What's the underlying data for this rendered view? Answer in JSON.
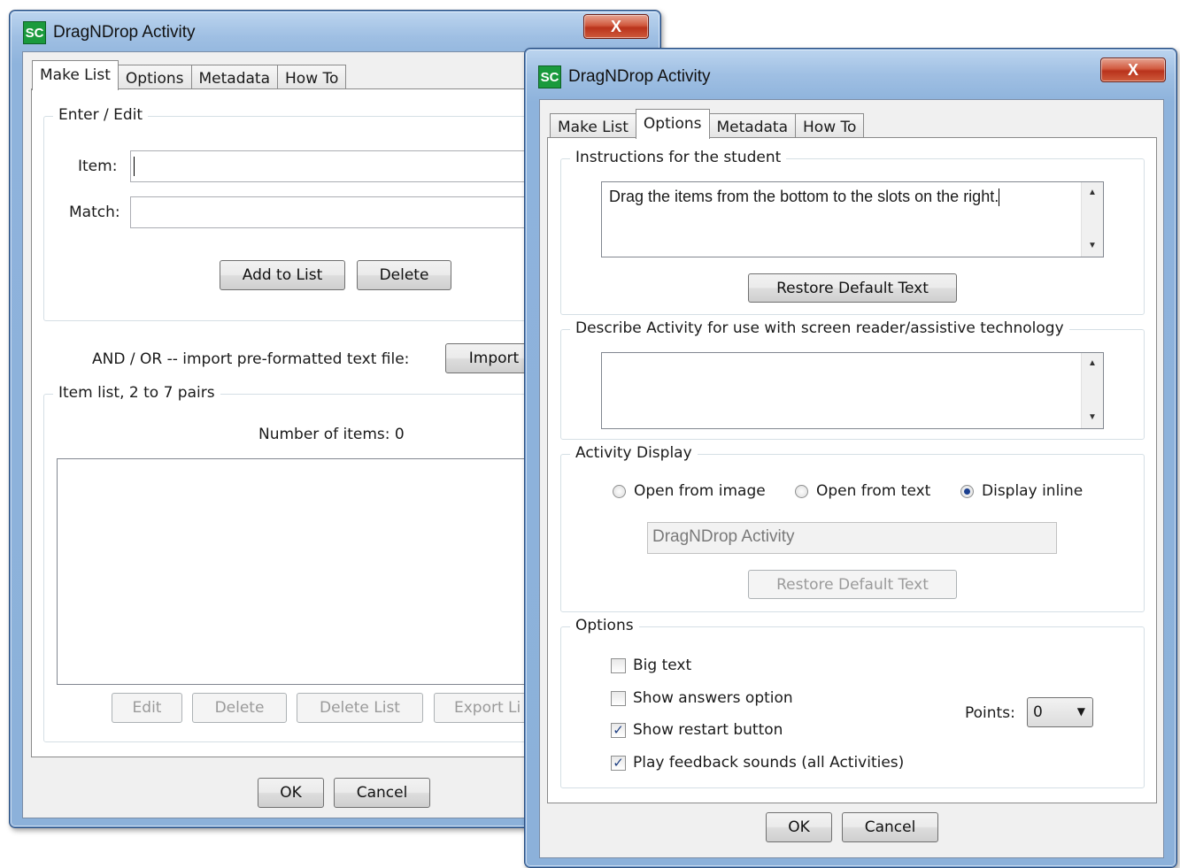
{
  "back_window": {
    "title": "DragNDrop Activity",
    "app_icon": "SC",
    "close_label": "X",
    "tabs": [
      "Make List",
      "Options",
      "Metadata",
      "How To"
    ],
    "enter_edit": {
      "legend": "Enter / Edit",
      "item_label": "Item:",
      "match_label": "Match:",
      "add_button": "Add to List",
      "delete_button": "Delete"
    },
    "import_text": "AND / OR -- import pre-formatted text file:",
    "import_button": "Import",
    "item_list": {
      "legend": "Item list, 2 to 7 pairs",
      "count_text": "Number of items: 0",
      "edit_button": "Edit",
      "delete_button": "Delete",
      "delete_list_button": "Delete List",
      "export_button": "Export Li"
    },
    "ok_button": "OK",
    "cancel_button": "Cancel"
  },
  "front_window": {
    "title": "DragNDrop Activity",
    "app_icon": "SC",
    "close_label": "X",
    "tabs": [
      "Make List",
      "Options",
      "Metadata",
      "How To"
    ],
    "instructions": {
      "legend": "Instructions for the student",
      "text": "Drag the items from the bottom to the slots on the right.",
      "restore_button": "Restore Default Text"
    },
    "describe": {
      "legend": "Describe Activity for use with screen reader/assistive technology",
      "text": ""
    },
    "display": {
      "legend": "Activity Display",
      "options": [
        "Open from image",
        "Open from text",
        "Display inline"
      ],
      "selected": "Display inline",
      "title_value": "DragNDrop Activity",
      "restore_button": "Restore Default Text"
    },
    "options": {
      "legend": "Options",
      "big_text": "Big text",
      "big_text_checked": false,
      "show_answers": "Show answers option",
      "show_answers_checked": false,
      "show_restart": "Show restart button",
      "show_restart_checked": true,
      "play_sounds": "Play feedback sounds (all Activities)",
      "play_sounds_checked": true,
      "points_label": "Points:",
      "points_value": "0"
    },
    "ok_button": "OK",
    "cancel_button": "Cancel"
  },
  "icons": {
    "checkmark": "✓",
    "dropdown": "▼",
    "scroll_up": "▲",
    "scroll_down": "▼"
  }
}
